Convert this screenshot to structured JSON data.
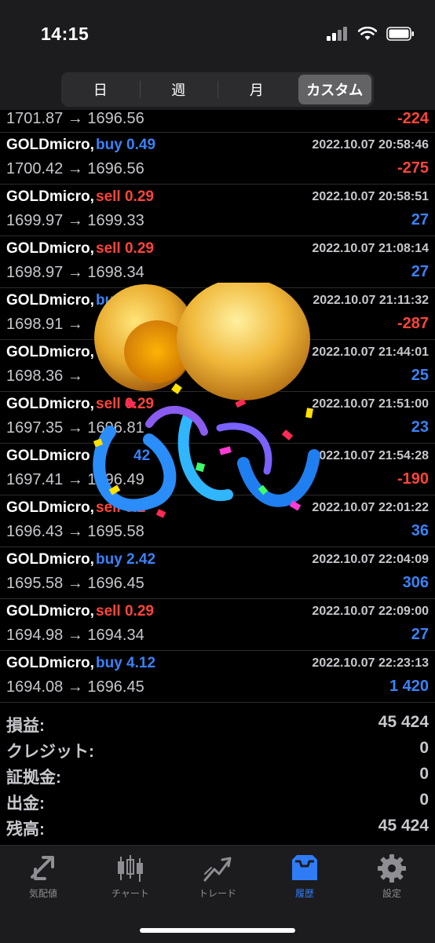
{
  "status": {
    "time": "14:15"
  },
  "segments": [
    {
      "label": "日",
      "active": false
    },
    {
      "label": "週",
      "active": false
    },
    {
      "label": "月",
      "active": false
    },
    {
      "label": "カスタム",
      "active": true
    }
  ],
  "partial_row": {
    "prices": "1701.87 → 1696.56",
    "profit": "-224"
  },
  "trades": [
    {
      "symbol": "GOLDmicro,",
      "side": "buy 0.49",
      "type": "buy",
      "datetime": "2022.10.07 20:58:46",
      "prices": "1700.42 → 1696.56",
      "profit": "-275"
    },
    {
      "symbol": "GOLDmicro,",
      "side": "sell 0.29",
      "type": "sell",
      "datetime": "2022.10.07 20:58:51",
      "prices": "1699.97 → 1699.33",
      "profit": "27"
    },
    {
      "symbol": "GOLDmicro,",
      "side": "sell 0.29",
      "type": "sell",
      "datetime": "2022.10.07 21:08:14",
      "prices": "1698.97 → 1698.34",
      "profit": "27"
    },
    {
      "symbol": "GOLDmicro,",
      "side": "bu",
      "type": "buy",
      "datetime": "2022.10.07 21:11:32",
      "prices": "1698.91 →",
      "profit": "-287"
    },
    {
      "symbol": "GOLDmicro,",
      "side": "",
      "type": "buy",
      "datetime": "2022.10.07 21:44:01",
      "prices": "1698.36 →",
      "profit": "25"
    },
    {
      "symbol": "GOLDmicro,",
      "side": "sell 0.29",
      "type": "sell",
      "datetime": "2022.10.07 21:51:00",
      "prices": "1697.35 → 1696.81",
      "profit": "23"
    },
    {
      "symbol": "GOLDmicro",
      "side": "42",
      "type": "buy",
      "datetime": "2022.10.07 21:54:28",
      "prices": "1697.41 → 1696.49",
      "profit": "-190"
    },
    {
      "symbol": "GOLDmicro,",
      "side": "sell 0.2",
      "type": "sell",
      "datetime": "2022.10.07 22:01:22",
      "prices": "1696.43 → 1695.58",
      "profit": "36"
    },
    {
      "symbol": "GOLDmicro,",
      "side": "buy 2.42",
      "type": "buy",
      "datetime": "2022.10.07 22:04:09",
      "prices": "1695.58 → 1696.45",
      "profit": "306"
    },
    {
      "symbol": "GOLDmicro,",
      "side": "sell 0.29",
      "type": "sell",
      "datetime": "2022.10.07 22:09:00",
      "prices": "1694.98 → 1694.34",
      "profit": "27"
    },
    {
      "symbol": "GOLDmicro,",
      "side": "buy 4.12",
      "type": "buy",
      "datetime": "2022.10.07 22:23:13",
      "prices": "1694.08 → 1696.45",
      "profit": "1 420"
    }
  ],
  "summary": [
    {
      "label": "損益:",
      "value": "45 424"
    },
    {
      "label": "クレジット:",
      "value": "0"
    },
    {
      "label": "証拠金:",
      "value": "0"
    },
    {
      "label": "出金:",
      "value": "0"
    },
    {
      "label": "残高:",
      "value": "45 424"
    }
  ],
  "tabs": [
    {
      "label": "気配値",
      "icon": "quotes-arrows-icon",
      "active": false
    },
    {
      "label": "チャート",
      "icon": "candlestick-chart-icon",
      "active": false
    },
    {
      "label": "トレード",
      "icon": "trade-chart-icon",
      "active": false
    },
    {
      "label": "履歴",
      "icon": "inbox-tray-icon",
      "active": true
    },
    {
      "label": "設定",
      "icon": "gear-icon",
      "active": false
    }
  ],
  "colors": {
    "buy": "#3a82f7",
    "sell": "#ff4538",
    "active_tab": "#2f7cf6"
  }
}
